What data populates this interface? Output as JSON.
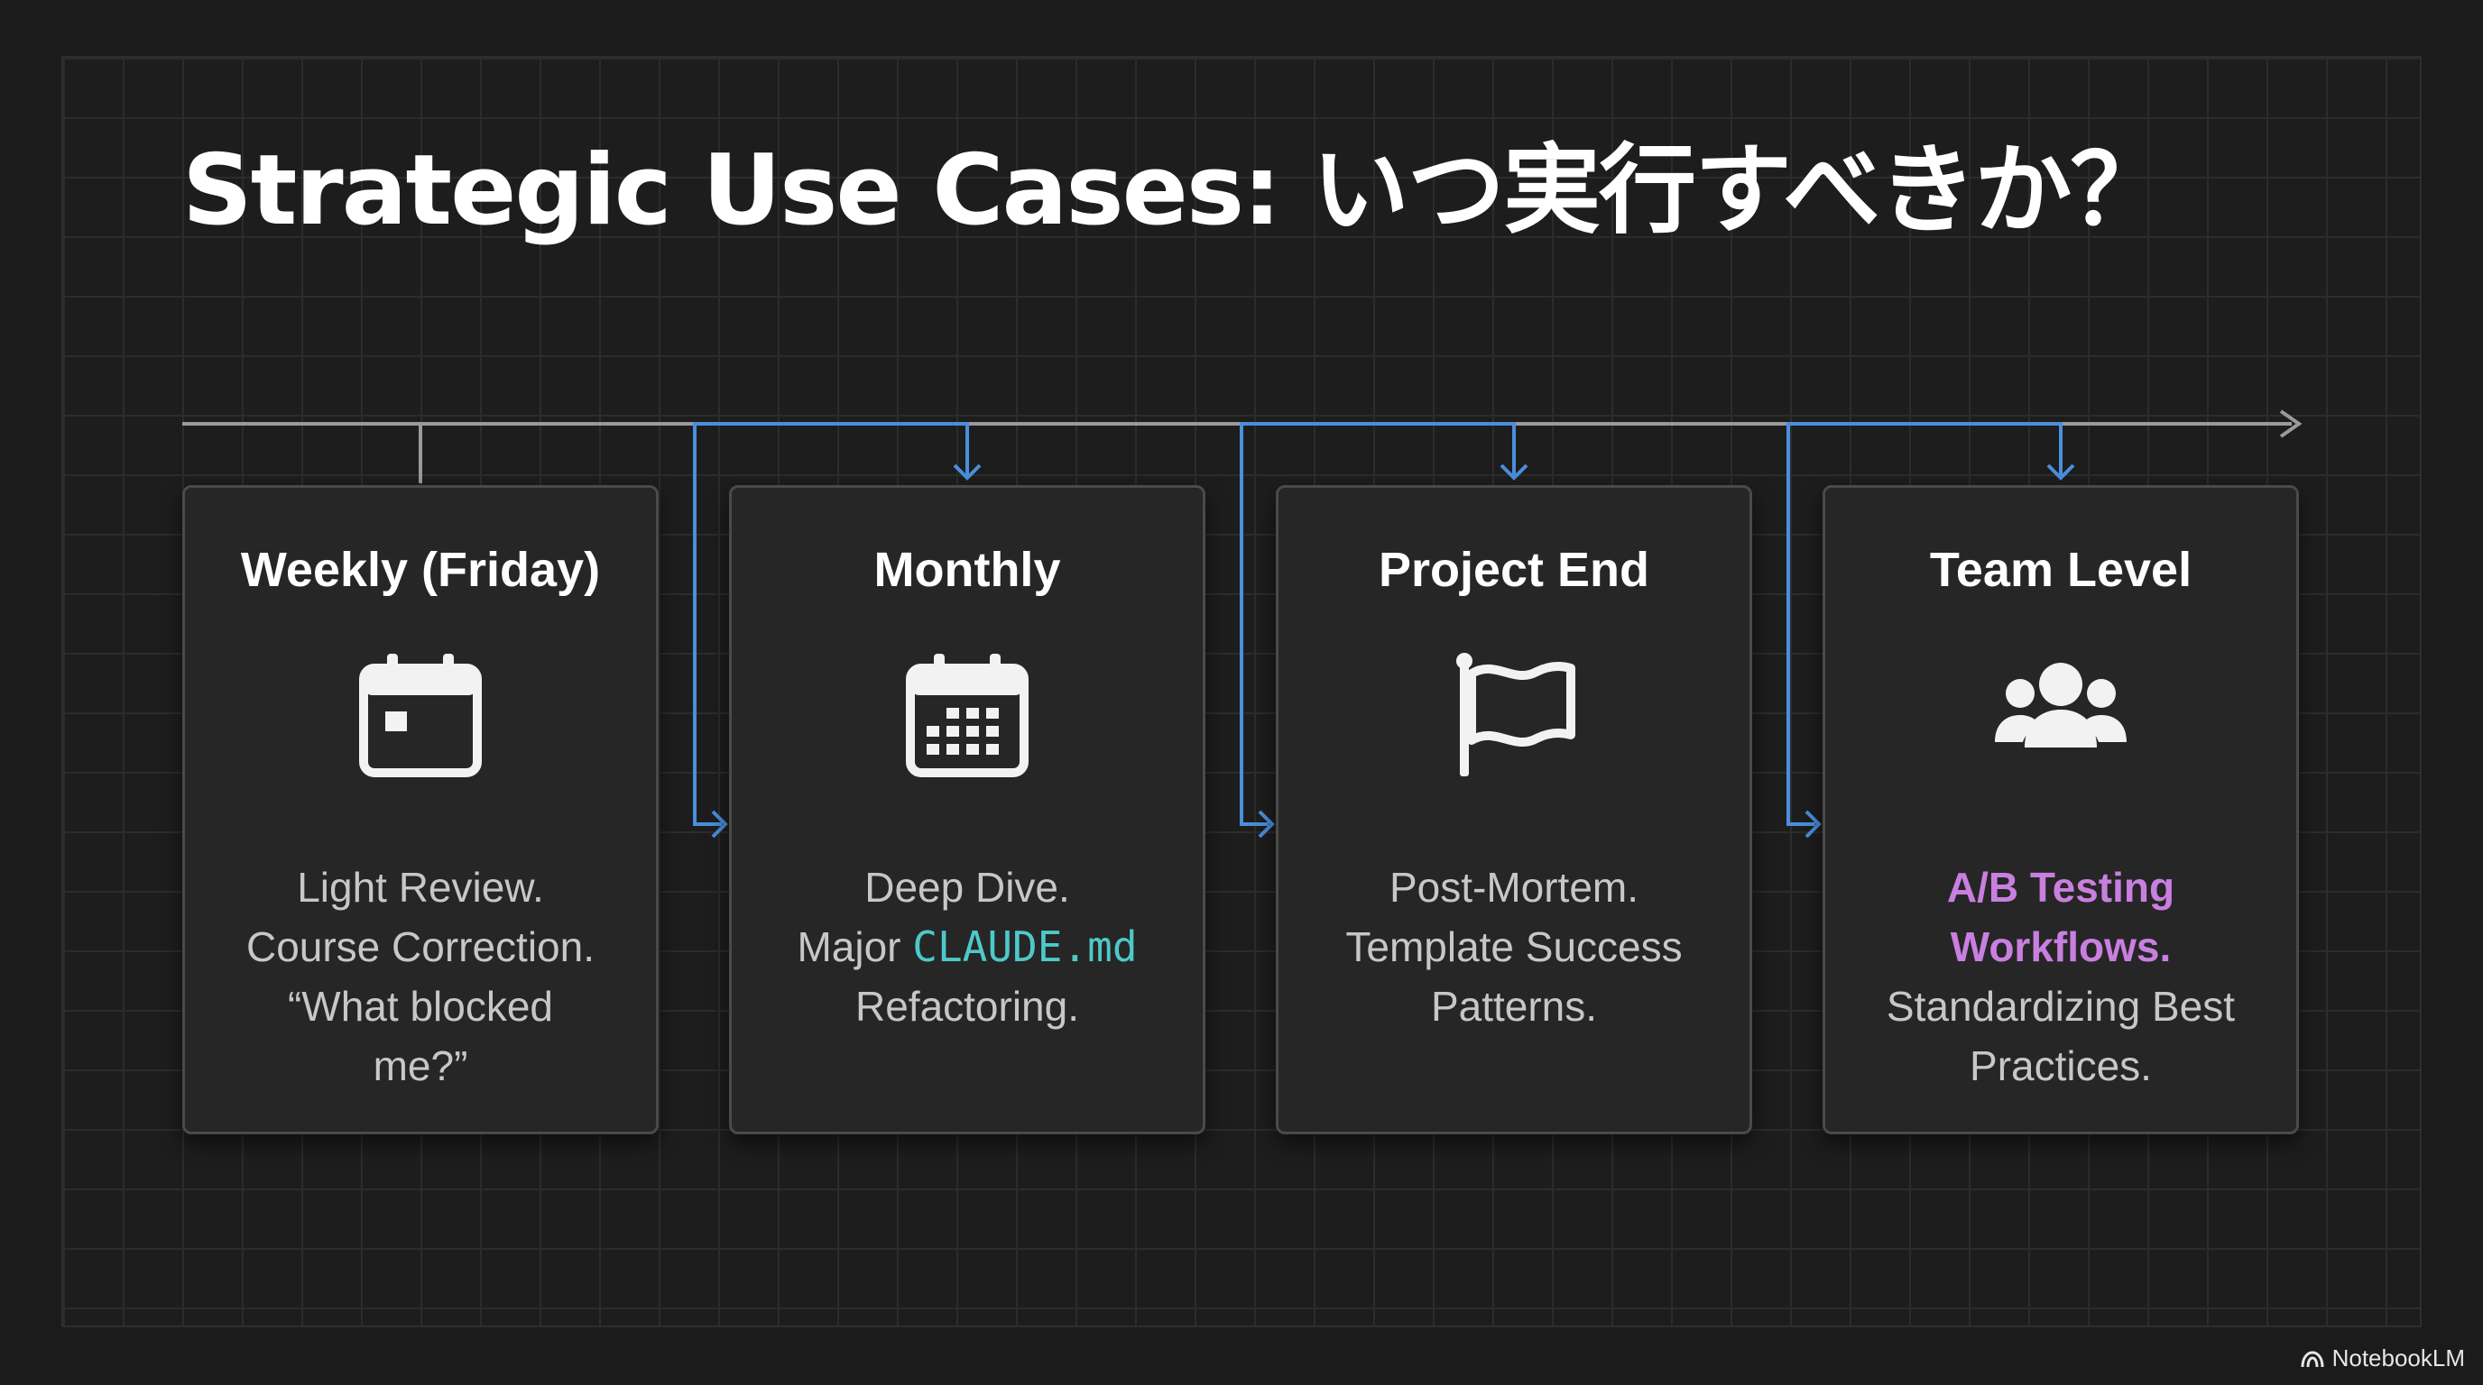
{
  "title": "Strategic Use Cases: いつ実行すべきか？",
  "cards": [
    {
      "title": "Weekly (Friday)",
      "icon": "calendar-icon",
      "lines": [
        "Light Review.",
        "Course Correction.",
        "“What blocked",
        "me?”"
      ]
    },
    {
      "title": "Monthly",
      "icon": "calendar-grid-icon",
      "line1": "Deep Dive.",
      "line2_prefix": "Major ",
      "line2_code": "CLAUDE.md",
      "line3": "Refactoring."
    },
    {
      "title": "Project End",
      "icon": "flag-icon",
      "lines": [
        "Post-Mortem.",
        "Template Success",
        "Patterns."
      ]
    },
    {
      "title": "Team Level",
      "icon": "users-icon",
      "highlight": [
        "A/B Testing",
        "Workflows."
      ],
      "lines": [
        "Standardizing Best",
        "Practices."
      ]
    }
  ],
  "watermark": "NotebookLM",
  "colors": {
    "background": "#1b1b1b",
    "card": "#262626",
    "connector": "#4a8fdc",
    "timeline": "#9a9a9a",
    "code": "#4ec9c9",
    "highlight": "#c97fe0"
  }
}
